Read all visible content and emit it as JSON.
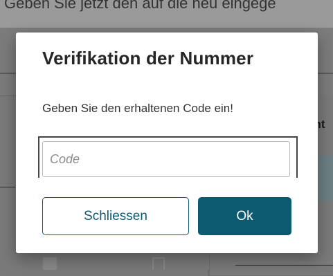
{
  "background": {
    "top_text": "Geben Sie jetzt den auf die neu eingege",
    "right_label": "ent",
    "right_teal_label": "ei"
  },
  "dialog": {
    "title": "Verifikation der Nummer",
    "text": "Geben Sie den erhaltenen Code ein!",
    "code_input": {
      "value": "",
      "placeholder": "Code"
    },
    "close_label": "Schliessen",
    "ok_label": "Ok"
  },
  "colors": {
    "accent": "#0c5a70",
    "overlay": "#7c7c7c"
  }
}
